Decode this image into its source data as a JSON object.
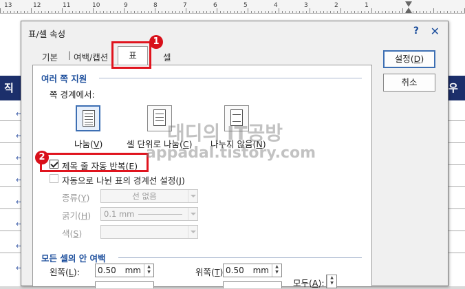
{
  "ruler": {
    "numbers": [
      "13",
      "12",
      "11",
      "10",
      "9",
      "8",
      "7",
      "6",
      "5",
      "4",
      "3",
      "2",
      "1"
    ]
  },
  "document": {
    "left_header": "직 위",
    "right_header": "우 ·",
    "row_arrow": "↩"
  },
  "dialog": {
    "title": "표/셀 속성",
    "help": "?",
    "close": "✕",
    "tabs": {
      "basic": "기본",
      "margin": "여백/캡션",
      "table": "표",
      "cell": "셀"
    },
    "section_multi_page": "여러 쪽 지원",
    "page_boundary_label": "쪽 경계에서:",
    "split_options": [
      {
        "label": "나눔(",
        "key": "V",
        "tail": ")"
      },
      {
        "label": "셀 단위로 나눔(",
        "key": "C",
        "tail": ")"
      },
      {
        "label": "나누지 않음(",
        "key": "N",
        "tail": ")"
      }
    ],
    "repeat_title_row": {
      "label": "제목 줄 자동 반복(",
      "key": "E",
      "tail": ")",
      "checked": true
    },
    "auto_split_border": {
      "label": "자동으로 나뉜 표의 경계선 설정(",
      "key": "J",
      "tail": ")",
      "checked": false
    },
    "type_label": {
      "label": "종류(",
      "key": "Y",
      "tail": ")"
    },
    "type_value": "선 없음",
    "thickness_label": {
      "label": "굵기(",
      "key": "H",
      "tail": ")"
    },
    "thickness_value": "0.1 mm",
    "color_label": {
      "label": "색(",
      "key": "S",
      "tail": ")"
    },
    "section_cell_margin": "모든 셀의 안 여백",
    "left_label": {
      "label": "왼쪽(",
      "key": "L",
      "tail": "):"
    },
    "left_value": "0.50",
    "top_label": {
      "label": "위쪽(",
      "key": "T",
      "tail": "):"
    },
    "top_value": "0.50",
    "unit": "mm",
    "all_label": {
      "label": "모두(",
      "key": "A",
      "tail": "):"
    }
  },
  "buttons": {
    "ok": {
      "label": "설정(",
      "key": "D",
      "tail": ")"
    },
    "cancel": "취소"
  },
  "badges": {
    "one": "1",
    "two": "2"
  },
  "watermark": {
    "line1": "대디의 IT공방",
    "line2": "appadal.tistory.com"
  },
  "colors": {
    "accent": "#1c4e9c",
    "highlight": "#e0141e",
    "header_bar": "#1c2f6b"
  }
}
